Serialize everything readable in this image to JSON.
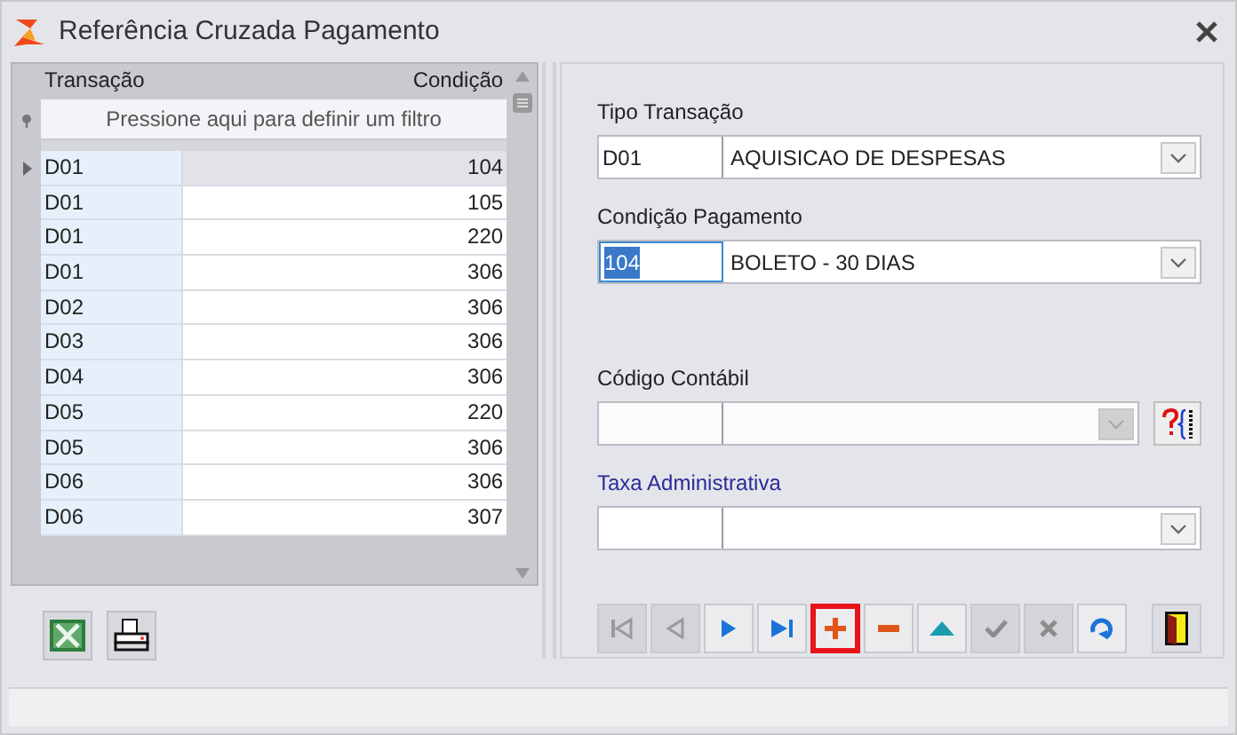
{
  "window": {
    "title": "Referência Cruzada Pagamento"
  },
  "grid": {
    "columns": [
      "Transação",
      "Condição"
    ],
    "filter_placeholder": "Pressione aqui para definir um filtro",
    "rows": [
      {
        "transacao": "D01",
        "condicao": "104",
        "selected": true
      },
      {
        "transacao": "D01",
        "condicao": "105",
        "selected": false
      },
      {
        "transacao": "D01",
        "condicao": "220",
        "selected": false
      },
      {
        "transacao": "D01",
        "condicao": "306",
        "selected": false
      },
      {
        "transacao": "D02",
        "condicao": "306",
        "selected": false
      },
      {
        "transacao": "D03",
        "condicao": "306",
        "selected": false
      },
      {
        "transacao": "D04",
        "condicao": "306",
        "selected": false
      },
      {
        "transacao": "D05",
        "condicao": "220",
        "selected": false
      },
      {
        "transacao": "D05",
        "condicao": "306",
        "selected": false
      },
      {
        "transacao": "D06",
        "condicao": "306",
        "selected": false
      },
      {
        "transacao": "D06",
        "condicao": "307",
        "selected": false
      }
    ]
  },
  "grid_buttons": [
    {
      "kind": "excel"
    },
    {
      "kind": "print"
    }
  ],
  "fields": [
    {
      "label": "Tipo Transação",
      "code": "D01",
      "description": "AQUISICAO DE DESPESAS",
      "code_selected": false,
      "disabled": false,
      "emphasis": false,
      "lookup_button": false
    },
    {
      "label": "Condição Pagamento",
      "code": "104",
      "description": "BOLETO - 30 DIAS",
      "code_selected": true,
      "disabled": false,
      "emphasis": false,
      "lookup_button": false
    },
    {
      "label": "Código Contábil",
      "disabled": true,
      "code_selected": false,
      "emphasis": false,
      "lookup_button": true
    },
    {
      "label": "Taxa Administrativa",
      "disabled": false,
      "code_selected": false,
      "emphasis": true,
      "lookup_button": false
    }
  ],
  "navigator": [
    {
      "kind": "first",
      "disabled": true,
      "highlighted": false
    },
    {
      "kind": "prior",
      "disabled": true,
      "highlighted": false
    },
    {
      "kind": "next",
      "disabled": false,
      "highlighted": false
    },
    {
      "kind": "last",
      "disabled": false,
      "highlighted": false
    },
    {
      "kind": "insert",
      "disabled": false,
      "highlighted": true
    },
    {
      "kind": "delete",
      "disabled": false,
      "highlighted": false
    },
    {
      "kind": "edit",
      "disabled": false,
      "highlighted": false
    },
    {
      "kind": "post",
      "disabled": true,
      "highlighted": false
    },
    {
      "kind": "cancel",
      "disabled": true,
      "highlighted": false
    },
    {
      "kind": "refresh",
      "disabled": false,
      "highlighted": false
    }
  ],
  "exit_button": {
    "kind": "exit"
  }
}
